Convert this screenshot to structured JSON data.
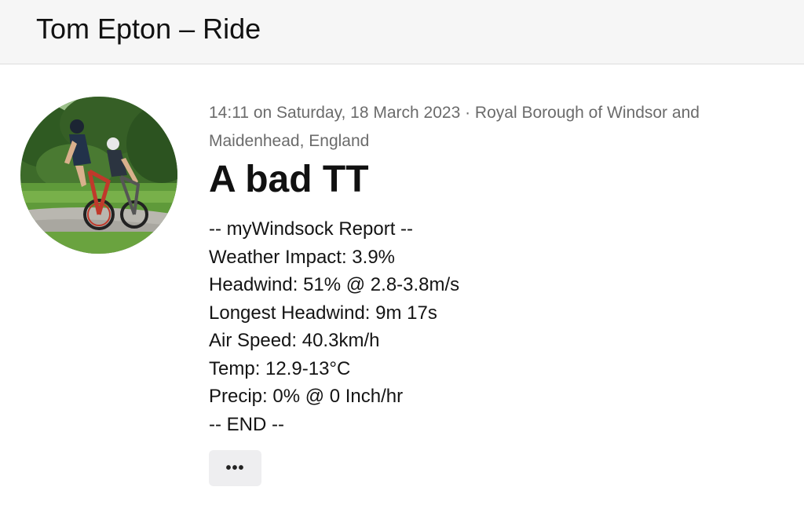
{
  "header": {
    "title": "Tom Epton – Ride"
  },
  "avatar": {
    "icon": "profile-photo-cyclists"
  },
  "activity": {
    "meta": "14:11 on Saturday, 18 March 2023 · Royal Borough of Windsor and Maidenhead, England",
    "title": "A bad TT",
    "description": [
      "-- myWindsock Report --",
      "Weather Impact: 3.9%",
      "Headwind: 51% @ 2.8-3.8m/s",
      "Longest Headwind: 9m 17s",
      "Air Speed: 40.3km/h",
      "Temp: 12.9-13°C",
      "Precip: 0% @ 0 Inch/hr",
      "-- END --"
    ]
  },
  "actions": {
    "more_label": "•••",
    "more_icon": "more-dots-icon"
  },
  "colors": {
    "header_bg": "#f6f6f6",
    "meta_text": "#6b6b6b",
    "button_bg": "#eeeef0"
  }
}
